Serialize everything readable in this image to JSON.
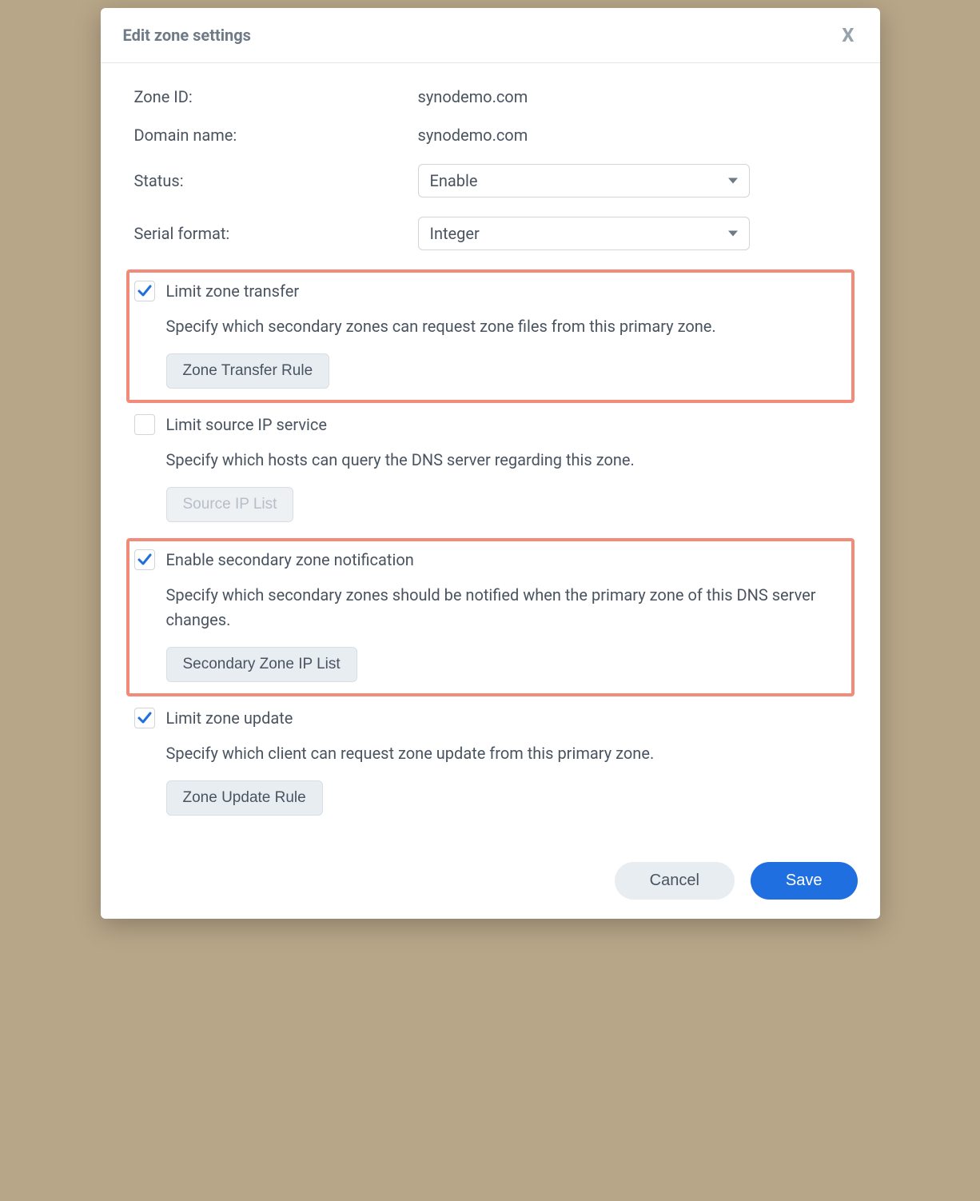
{
  "dialog": {
    "title": "Edit zone settings",
    "fields": {
      "zone_id_label": "Zone ID:",
      "zone_id_value": "synodemo.com",
      "domain_name_label": "Domain name:",
      "domain_name_value": "synodemo.com",
      "status_label": "Status:",
      "status_value": "Enable",
      "serial_format_label": "Serial format:",
      "serial_format_value": "Integer"
    },
    "sections": {
      "limit_zone_transfer": {
        "checked": true,
        "highlighted": true,
        "label": "Limit zone transfer",
        "desc": "Specify which secondary zones can request zone files from this primary zone.",
        "button": "Zone Transfer Rule",
        "button_enabled": true
      },
      "limit_source_ip": {
        "checked": false,
        "highlighted": false,
        "label": "Limit source IP service",
        "desc": "Specify which hosts can query the DNS server regarding this zone.",
        "button": "Source IP List",
        "button_enabled": false
      },
      "secondary_notification": {
        "checked": true,
        "highlighted": true,
        "label": "Enable secondary zone notification",
        "desc": "Specify which secondary zones should be notified when the primary zone of this DNS server changes.",
        "button": "Secondary Zone IP List",
        "button_enabled": true
      },
      "limit_zone_update": {
        "checked": true,
        "highlighted": false,
        "label": "Limit zone update",
        "desc": "Specify which client can request zone update from this primary zone.",
        "button": "Zone Update Rule",
        "button_enabled": true
      }
    },
    "footer": {
      "cancel": "Cancel",
      "save": "Save"
    }
  }
}
